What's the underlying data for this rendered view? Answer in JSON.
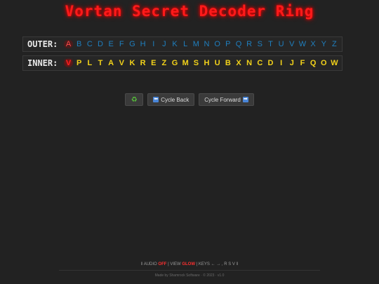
{
  "title": "Vortan Secret Decoder Ring",
  "outer": {
    "label": "OUTER:",
    "letters": [
      "A",
      "B",
      "C",
      "D",
      "E",
      "F",
      "G",
      "H",
      "I",
      "J",
      "K",
      "L",
      "M",
      "N",
      "O",
      "P",
      "Q",
      "R",
      "S",
      "T",
      "U",
      "V",
      "W",
      "X",
      "Y",
      "Z"
    ],
    "active_index": 0
  },
  "inner": {
    "label": "INNER:",
    "letters": [
      "V",
      "P",
      "L",
      "T",
      "A",
      "V",
      "K",
      "R",
      "E",
      "Z",
      "G",
      "M",
      "S",
      "H",
      "U",
      "B",
      "X",
      "N",
      "C",
      "D",
      "I",
      "J",
      "F",
      "Q",
      "O",
      "W"
    ],
    "active_index": 0
  },
  "controls": {
    "reset_icon": "♻",
    "cycle_back_label": "Cycle Back",
    "cycle_back_icon": "⬅",
    "cycle_forward_label": "Cycle Forward",
    "cycle_forward_icon": "➡"
  },
  "footer": {
    "audio_label": "AUDIO",
    "audio_state": "OFF",
    "view_label": "VIEW",
    "view_state": "GLOW",
    "keys_label": "KEYS",
    "keys_value": "← → , R S V",
    "credit": "Made by Shamrock Software · © 2023 · v1.0"
  },
  "colors": {
    "background": "#222222",
    "title": "#ff1a1a",
    "outer_letters": "#1f7fbf",
    "inner_letters": "#f2d21a",
    "active": "#ff2020"
  }
}
